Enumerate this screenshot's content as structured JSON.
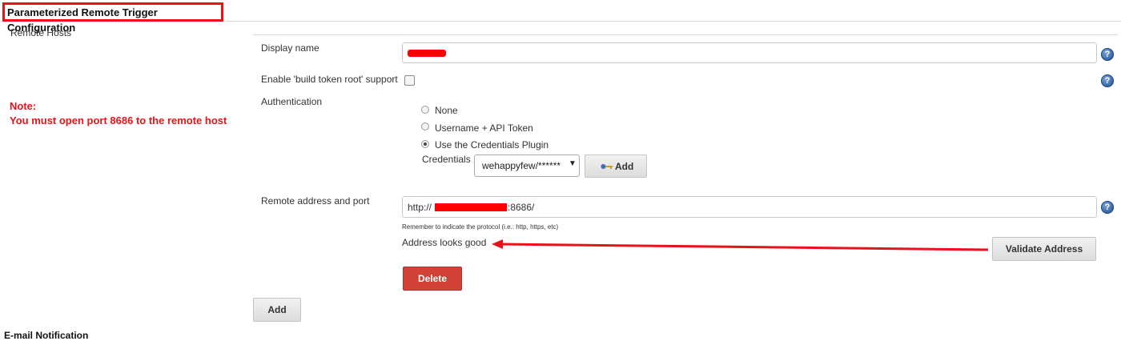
{
  "section": {
    "title": "Parameterized Remote Trigger Configuration",
    "remote_hosts_label": "Remote Hosts"
  },
  "note": {
    "line1": "Note:",
    "line2": "You must open port 8686 to the remote host"
  },
  "form": {
    "display_name_label": "Display name",
    "display_name_value": "",
    "build_token_label": "Enable 'build token root' support",
    "build_token_checked": false,
    "authentication_label": "Authentication",
    "auth_options": [
      {
        "label": "None",
        "selected": false
      },
      {
        "label": "Username + API Token",
        "selected": false
      },
      {
        "label": "Use the Credentials Plugin",
        "selected": true
      }
    ],
    "credentials_label": "Credentials",
    "credentials_value": "wehappyfew/******",
    "credentials_add_label": "Add",
    "remote_address_label": "Remote address and port",
    "remote_address_prefix": "http://",
    "remote_address_suffix": ":8686/",
    "remote_address_hint": "Remember to indicate the protocol (i.e.: http, https, etc)",
    "validation_message": "Address looks good",
    "validate_button_label": "Validate Address",
    "delete_button_label": "Delete"
  },
  "add_host_button_label": "Add",
  "next_section_title": "E-mail Notification",
  "colors": {
    "annotation_red": "#e8131a",
    "delete_red": "#d24135",
    "help_blue": "#2f5f9e"
  },
  "icons": {
    "help": "help-icon",
    "key": "key-icon",
    "dropdown": "dropdown-arrow-icon"
  }
}
